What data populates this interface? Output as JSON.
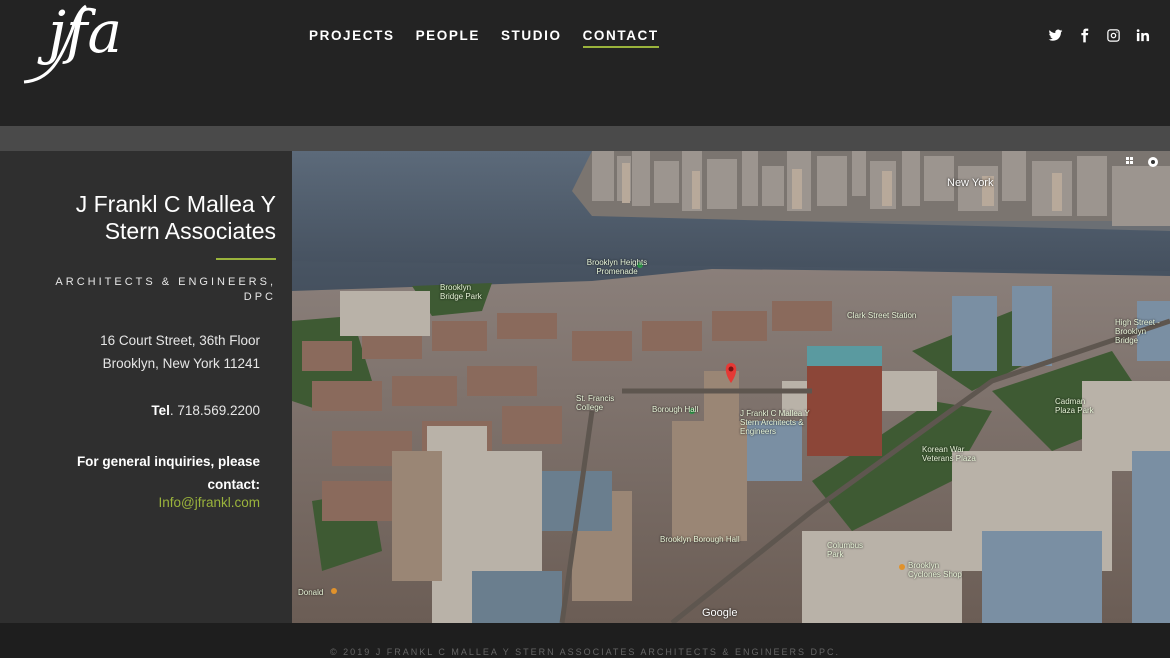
{
  "header": {
    "logo_text": "jfa",
    "nav": [
      {
        "label": "PROJECTS"
      },
      {
        "label": "PEOPLE"
      },
      {
        "label": "STUDIO"
      },
      {
        "label": "CONTACT",
        "active": true
      }
    ],
    "social_icons": [
      "twitter-icon",
      "facebook-icon",
      "instagram-icon",
      "linkedin-icon"
    ]
  },
  "contact": {
    "firm_name": "J Frankl C Mallea Y Stern Associates",
    "firm_subtitle": "ARCHITECTS & ENGINEERS, DPC",
    "address_line1": "16 Court Street, 36th Floor",
    "address_line2": "Brooklyn, New York 11241",
    "tel_label": "Tel",
    "tel_number": ". 718.569.2200",
    "inquiry_text": "For general inquiries, please contact:",
    "email": "Info@jfrankl.com"
  },
  "map": {
    "labels": {
      "new_york": "New York",
      "promenade": "Brooklyn Heights Promenade",
      "bridge_park": "Brooklyn Bridge Park",
      "borough_hall_stop": "Brooklyn Borough Hall",
      "clark_st": "Clark Street Station",
      "high_st": "High Street - Brooklyn Bridge",
      "st_francis": "St. Francis College",
      "jfa_pin": "J Frankl C Mallea Y Stern Architects & Engineers",
      "borough_hall": "Borough Hall",
      "korean_war": "Korean War Veterans Plaza",
      "cadman": "Cadman Plaza Park",
      "columbus": "Columbus Park",
      "donald": "Donald",
      "shake_shack": "Brooklyn Cyclones Shop"
    },
    "attribution": "Google"
  },
  "footer": {
    "copyright": "© 2019 J FRANKL C MALLEA Y STERN ASSOCIATES ARCHITECTS & ENGINEERS DPC."
  },
  "colors": {
    "accent": "#9ab33c",
    "header_bg": "#232323",
    "sidebar_bg": "#2f2f2f",
    "band": "#4a4a4a"
  }
}
